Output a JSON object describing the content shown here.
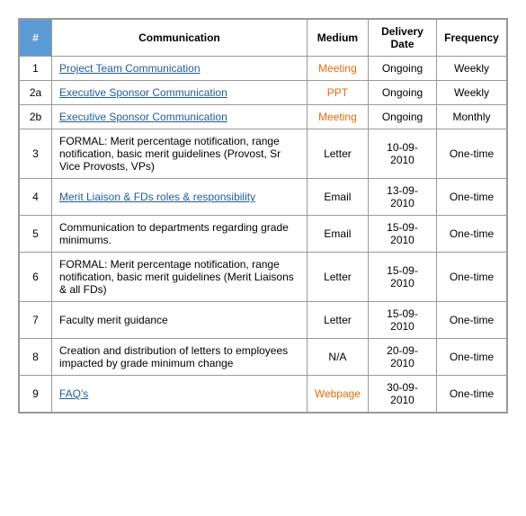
{
  "table": {
    "headers": [
      "#",
      "Communication",
      "Medium",
      "Delivery Date",
      "Frequency"
    ],
    "rows": [
      {
        "id": "1",
        "communication": "Project Team Communication",
        "communication_style": "link",
        "medium": "Meeting",
        "medium_style": "orange",
        "delivery_date": "Ongoing",
        "frequency": "Weekly"
      },
      {
        "id": "2a",
        "communication": "Executive Sponsor Communication",
        "communication_style": "link",
        "medium": "PPT",
        "medium_style": "orange",
        "delivery_date": "Ongoing",
        "frequency": "Weekly"
      },
      {
        "id": "2b",
        "communication": "Executive Sponsor Communication",
        "communication_style": "link",
        "medium": "Meeting",
        "medium_style": "orange",
        "delivery_date": "Ongoing",
        "frequency": "Monthly"
      },
      {
        "id": "3",
        "communication": "FORMAL: Merit percentage notification, range notification, basic merit guidelines (Provost, Sr Vice Provosts, VPs)",
        "communication_style": "normal",
        "medium": "Letter",
        "medium_style": "normal",
        "delivery_date": "10-09-2010",
        "frequency": "One-time"
      },
      {
        "id": "4",
        "communication": "Merit Liaison & FDs roles & responsibility",
        "communication_style": "link",
        "medium": "Email",
        "medium_style": "normal",
        "delivery_date": "13-09-2010",
        "frequency": "One-time"
      },
      {
        "id": "5",
        "communication": "Communication to departments regarding grade minimums.",
        "communication_style": "normal",
        "medium": "Email",
        "medium_style": "normal",
        "delivery_date": "15-09-2010",
        "frequency": "One-time"
      },
      {
        "id": "6",
        "communication": "FORMAL: Merit percentage notification, range notification, basic merit guidelines (Merit Liaisons & all FDs)",
        "communication_style": "normal",
        "medium": "Letter",
        "medium_style": "normal",
        "delivery_date": "15-09-2010",
        "frequency": "One-time"
      },
      {
        "id": "7",
        "communication": "Faculty merit guidance",
        "communication_style": "normal",
        "medium": "Letter",
        "medium_style": "normal",
        "delivery_date": "15-09-2010",
        "frequency": "One-time"
      },
      {
        "id": "8",
        "communication": "Creation and distribution of letters to employees impacted by grade minimum change",
        "communication_style": "normal",
        "medium": "N/A",
        "medium_style": "normal",
        "delivery_date": "20-09-2010",
        "frequency": "One-time"
      },
      {
        "id": "9",
        "communication": "FAQ's",
        "communication_style": "link",
        "medium": "Webpage",
        "medium_style": "orange",
        "delivery_date": "30-09-2010",
        "frequency": "One-time"
      }
    ]
  }
}
